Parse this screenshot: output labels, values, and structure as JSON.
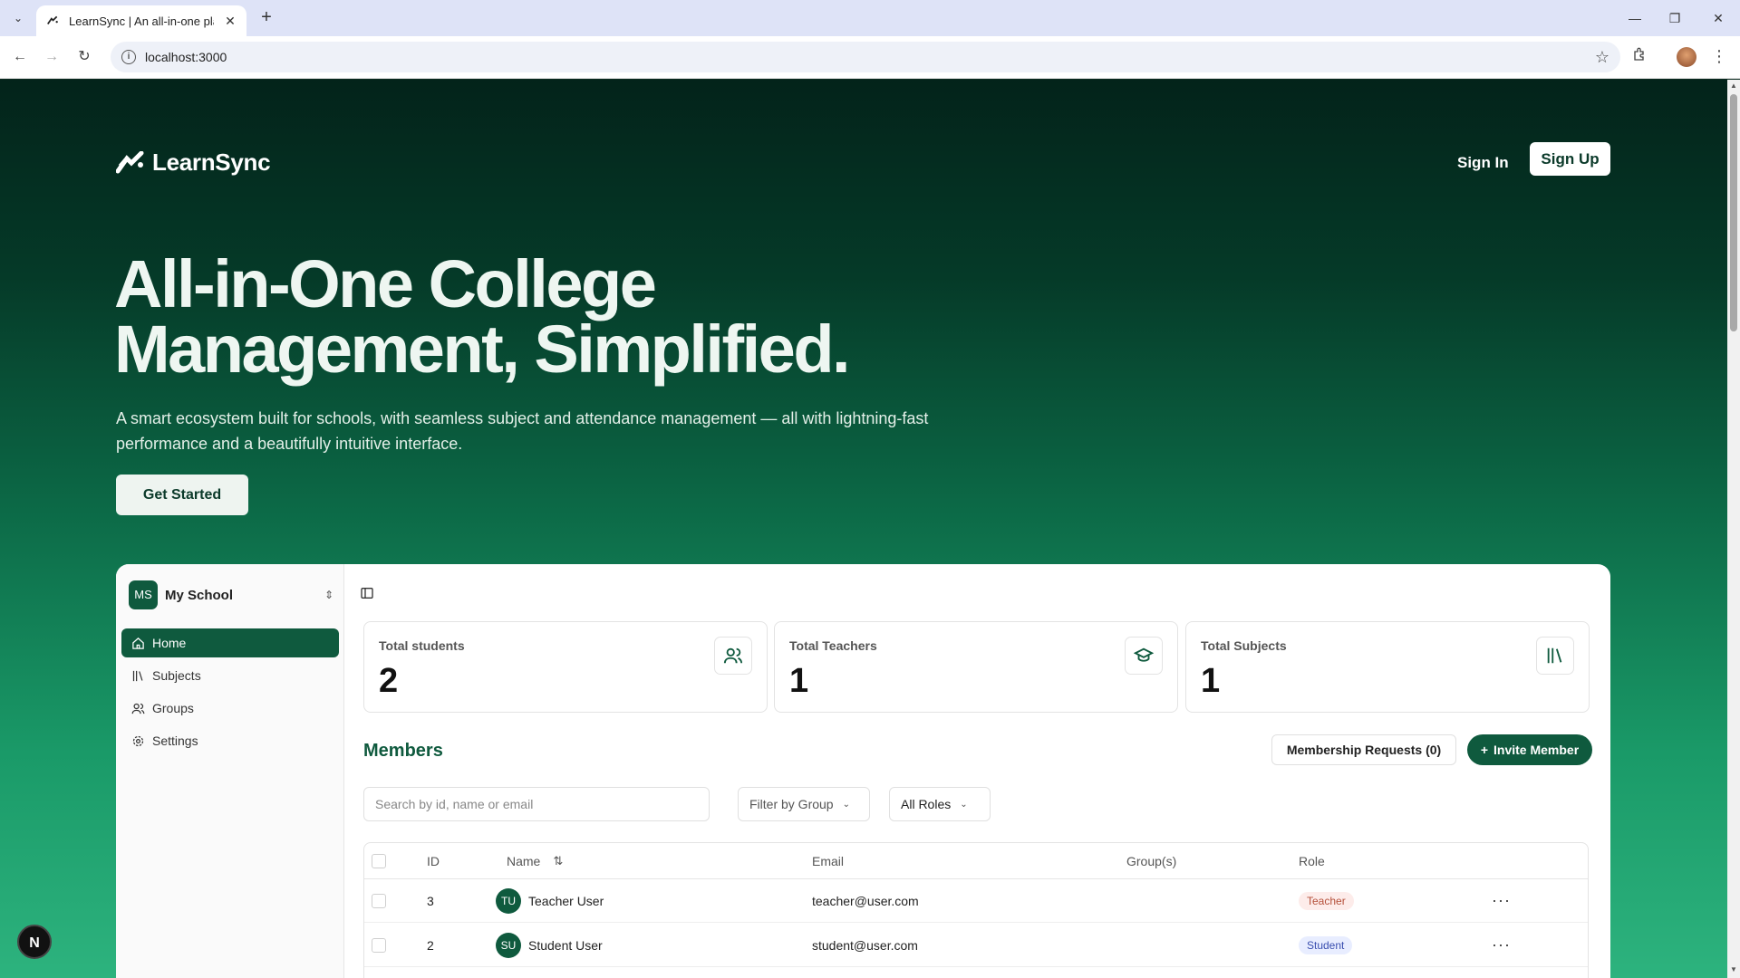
{
  "browser": {
    "tab_title": "LearnSync | An all-in-one platfo",
    "url": "localhost:3000"
  },
  "header": {
    "logo_text": "LearnSync",
    "sign_in": "Sign In",
    "sign_up": "Sign Up"
  },
  "hero": {
    "title_line1": "All-in-One College",
    "title_line2": "Management, Simplified.",
    "subtitle": "A smart ecosystem built for schools, with seamless subject and attendance management — all with lightning-fast performance and a beautifully intuitive interface.",
    "cta": "Get Started"
  },
  "app": {
    "school": {
      "initials": "MS",
      "name": "My School"
    },
    "nav": [
      {
        "label": "Home",
        "icon": "home-icon",
        "active": true
      },
      {
        "label": "Subjects",
        "icon": "books-icon",
        "active": false
      },
      {
        "label": "Groups",
        "icon": "users-icon",
        "active": false
      },
      {
        "label": "Settings",
        "icon": "gear-icon",
        "active": false
      }
    ],
    "stats": [
      {
        "label": "Total students",
        "value": "2",
        "icon": "users-icon"
      },
      {
        "label": "Total Teachers",
        "value": "1",
        "icon": "graduation-cap-icon"
      },
      {
        "label": "Total Subjects",
        "value": "1",
        "icon": "library-icon"
      }
    ],
    "members": {
      "title": "Members",
      "requests_button": "Membership Requests (0)",
      "invite_button": "Invite Member",
      "search_placeholder": "Search by id, name or email",
      "filter_group": "Filter by Group",
      "filter_role": "All Roles",
      "columns": [
        "ID",
        "Name",
        "Email",
        "Group(s)",
        "Role"
      ],
      "rows": [
        {
          "id": "3",
          "initials": "TU",
          "name": "Teacher User",
          "email": "teacher@user.com",
          "groups": "",
          "role": "Teacher"
        },
        {
          "id": "2",
          "initials": "SU",
          "name": "Student User",
          "email": "student@user.com",
          "groups": "",
          "role": "Student"
        }
      ]
    }
  },
  "dev_badge": "N",
  "colors": {
    "brand": "#0f5a3e",
    "hero_top": "#03231a",
    "hero_bottom": "#2db37e",
    "teacher_badge": "#fdecea",
    "student_badge": "#e8edff"
  }
}
